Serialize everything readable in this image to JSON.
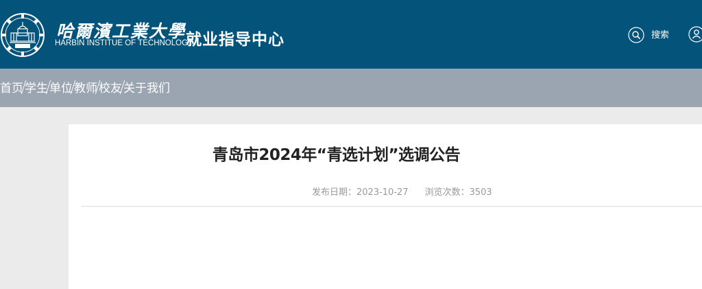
{
  "header": {
    "university_name_cn": "哈爾濱工業大學",
    "university_name_en": "HARBIN INSTITUE OF TECHNOLOGY",
    "site_title": "就业指导中心",
    "search_label": "搜索",
    "logo_icon": "university-seal-icon",
    "search_icon": "search-icon",
    "user_icon": "user-icon"
  },
  "nav": {
    "items": [
      "首页",
      "学生",
      "单位",
      "教师",
      "校友",
      "关于我们"
    ]
  },
  "article": {
    "title": "青岛市2024年“青选计划”选调公告",
    "publish_label": "发布日期：",
    "publish_date": "2023-10-27",
    "views_label": "浏览次数：",
    "views_count": "3503"
  },
  "colors": {
    "header_bg": "#03537a",
    "nav_bg": "#9ba4b1",
    "page_bg": "#ebebeb"
  }
}
